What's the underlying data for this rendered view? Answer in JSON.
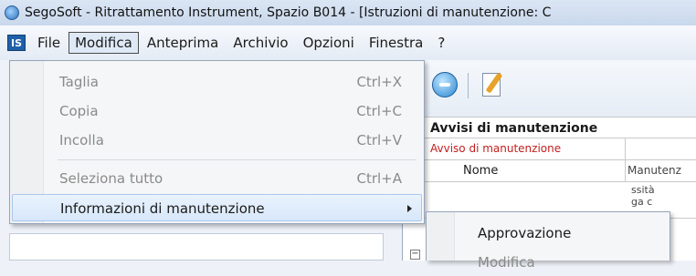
{
  "window": {
    "title": "SegoSoft - Ritrattamento Instrument, Spazio B014 - [Istruzioni di manutenzione: C"
  },
  "menubar": {
    "mdi_icon": "IS",
    "items": [
      {
        "label": "File"
      },
      {
        "label": "Modifica",
        "open": true
      },
      {
        "label": "Anteprima"
      },
      {
        "label": "Archivio"
      },
      {
        "label": "Opzioni"
      },
      {
        "label": "Finestra"
      },
      {
        "label": "?"
      }
    ]
  },
  "edit_menu": {
    "items": [
      {
        "label": "Taglia",
        "shortcut": "Ctrl+X",
        "enabled": false
      },
      {
        "label": "Copia",
        "shortcut": "Ctrl+C",
        "enabled": false
      },
      {
        "label": "Incolla",
        "shortcut": "Ctrl+V",
        "enabled": false
      },
      {
        "label": "Seleziona tutto",
        "shortcut": "Ctrl+A",
        "enabled": false
      },
      {
        "label": "Informazioni di manutenzione",
        "shortcut": "",
        "enabled": true,
        "has_submenu": true,
        "highlighted": true
      }
    ]
  },
  "submenu": {
    "items": [
      {
        "label": "Approvazione",
        "enabled": true
      },
      {
        "label": "Modifica",
        "enabled": false
      }
    ]
  },
  "grid": {
    "header": "Avvisi di manutenzione",
    "row_notice": "Avviso di manutenzione",
    "name_label": "Nome",
    "name_value": "Manutenz",
    "partial_line1": "ssità",
    "partial_line2": "ga c",
    "expander": "−"
  },
  "colors": {
    "accent_red": "#c21e1e",
    "highlight": "#d7e7fa"
  }
}
